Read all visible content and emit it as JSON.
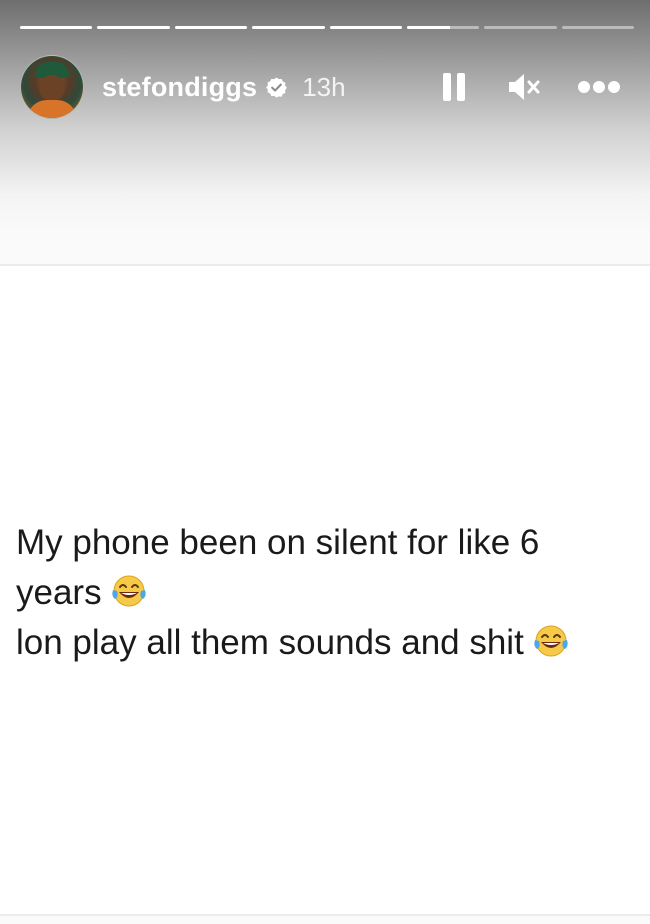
{
  "story": {
    "progress": [
      1,
      1,
      1,
      1,
      1,
      0.6,
      0,
      0
    ],
    "user": {
      "username": "stefondiggs",
      "verified": true,
      "timestamp": "13h"
    },
    "controls": {
      "pause": "pause-icon",
      "mute": "mute-icon",
      "more": "more-icon"
    }
  },
  "post": {
    "line1": "My phone been on silent for like 6",
    "line2": "years",
    "line3": "lon play all them sounds and shit",
    "emoji": "face-with-tears-of-joy"
  },
  "colors": {
    "verified_badge": "#ffffff",
    "text": "#1a1a1a"
  }
}
